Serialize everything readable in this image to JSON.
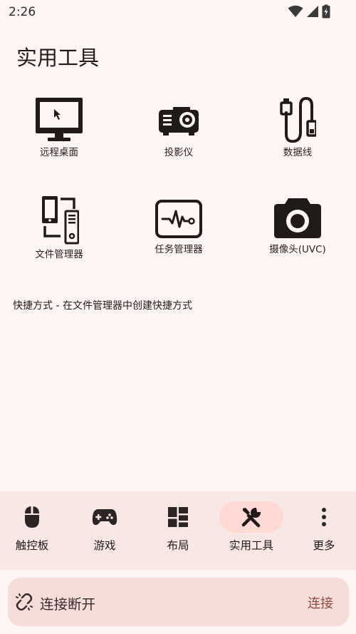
{
  "status_bar": {
    "time": "2:26",
    "icons": [
      "wifi-icon",
      "cell-signal-icon",
      "battery-icon"
    ]
  },
  "page": {
    "title": "实用工具"
  },
  "tools": [
    {
      "label": "远程桌面",
      "icon": "monitor-cursor-icon"
    },
    {
      "label": "投影仪",
      "icon": "projector-icon"
    },
    {
      "label": "数据线",
      "icon": "usb-cable-icon"
    },
    {
      "label": "文件管理器",
      "icon": "phone-pc-transfer-icon"
    },
    {
      "label": "任务管理器",
      "icon": "activity-monitor-icon"
    },
    {
      "label": "摄像头(UVC)",
      "icon": "camera-icon"
    }
  ],
  "shortcut_tip": "快捷方式 - 在文件管理器中创建快捷方式",
  "bottom_nav": {
    "active": "实用工具",
    "items": [
      {
        "label": "触控板",
        "icon": "mouse-icon"
      },
      {
        "label": "游戏",
        "icon": "gamepad-icon"
      },
      {
        "label": "布局",
        "icon": "layout-icon"
      },
      {
        "label": "实用工具",
        "icon": "tools-icon"
      },
      {
        "label": "更多",
        "icon": "more-vert-icon"
      }
    ]
  },
  "connection": {
    "status": "连接断开",
    "action": "连接",
    "icon": "link-off-icon"
  },
  "colors": {
    "background": "#FFF5F2",
    "nav_background": "#F7E8E5",
    "active_pill": "#FFDAD5",
    "connection_bar": "#F5DDD9",
    "connect_action": "#8F4A43",
    "icon_dark": "#201A19"
  }
}
